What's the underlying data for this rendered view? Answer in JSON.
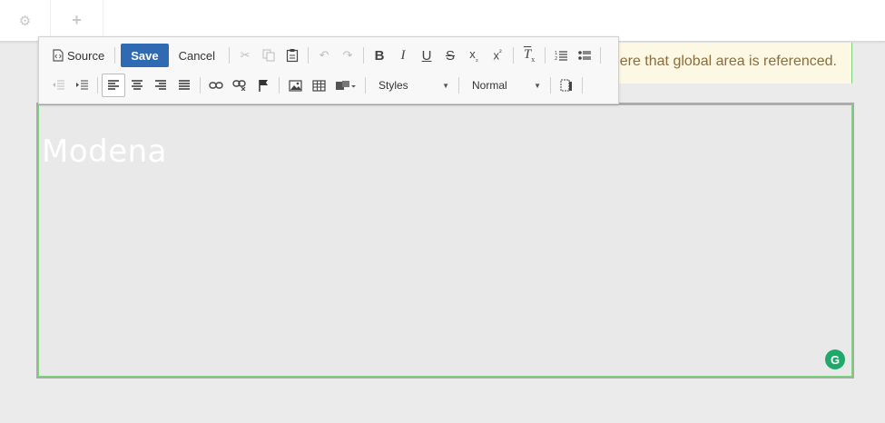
{
  "topbar": {
    "gear_icon": "gear-icon",
    "add_icon": "plus-icon"
  },
  "notice": {
    "text": "Any changes made here will be reflected everywhere that global area is referenced."
  },
  "toolbar": {
    "source_label": "Source",
    "save_label": "Save",
    "cancel_label": "Cancel",
    "styles_label": "Styles",
    "format_label": "Normal"
  },
  "editor": {
    "content_title": "Modena",
    "grammarly_glyph": "G"
  },
  "colors": {
    "save_bg": "#2f6ab3",
    "notice_bg": "#fcf8e3",
    "notice_text": "#8a6d3b",
    "grammarly": "#1faa6b",
    "editable_outline": "#7fd27f"
  }
}
